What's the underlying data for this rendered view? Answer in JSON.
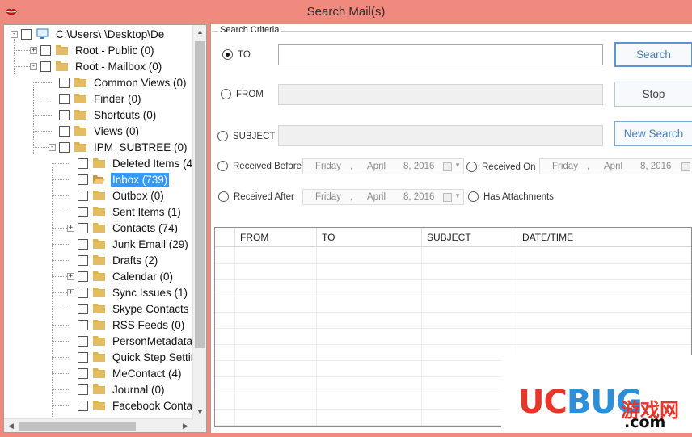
{
  "window": {
    "title": "Search Mail(s)"
  },
  "tree": {
    "items": [
      {
        "label": "C:\\Users\\         \\Desktop\\De",
        "level": 0,
        "expander": "-",
        "icon": "computer-icon"
      },
      {
        "label": "Root - Public (0)",
        "level": 1,
        "expander": "+",
        "icon": "folder-icon"
      },
      {
        "label": "Root - Mailbox (0)",
        "level": 1,
        "expander": "-",
        "icon": "folder-icon"
      },
      {
        "label": "Common Views (0)",
        "level": 2,
        "expander": "",
        "icon": "folder-icon"
      },
      {
        "label": "Finder (0)",
        "level": 2,
        "expander": "",
        "icon": "folder-icon"
      },
      {
        "label": "Shortcuts (0)",
        "level": 2,
        "expander": "",
        "icon": "folder-icon"
      },
      {
        "label": "Views (0)",
        "level": 2,
        "expander": "",
        "icon": "folder-icon"
      },
      {
        "label": "IPM_SUBTREE (0)",
        "level": 2,
        "expander": "-",
        "icon": "folder-icon"
      },
      {
        "label": "Deleted Items (4",
        "level": 3,
        "expander": "",
        "icon": "folder-icon"
      },
      {
        "label": "Inbox (739)",
        "level": 3,
        "expander": "",
        "icon": "open-folder-icon",
        "selected": true
      },
      {
        "label": "Outbox (0)",
        "level": 3,
        "expander": "",
        "icon": "folder-icon"
      },
      {
        "label": "Sent Items (1)",
        "level": 3,
        "expander": "",
        "icon": "folder-icon"
      },
      {
        "label": "Contacts (74)",
        "level": 3,
        "expander": "+",
        "icon": "folder-icon"
      },
      {
        "label": "Junk Email (29)",
        "level": 3,
        "expander": "",
        "icon": "folder-icon"
      },
      {
        "label": "Drafts (2)",
        "level": 3,
        "expander": "",
        "icon": "folder-icon"
      },
      {
        "label": "Calendar (0)",
        "level": 3,
        "expander": "+",
        "icon": "folder-icon"
      },
      {
        "label": "Sync Issues (1)",
        "level": 3,
        "expander": "+",
        "icon": "folder-icon"
      },
      {
        "label": "Skype Contacts (",
        "level": 3,
        "expander": "",
        "icon": "folder-icon"
      },
      {
        "label": "RSS Feeds (0)",
        "level": 3,
        "expander": "",
        "icon": "folder-icon"
      },
      {
        "label": "PersonMetadata",
        "level": 3,
        "expander": "",
        "icon": "folder-icon"
      },
      {
        "label": "Quick Step Settin",
        "level": 3,
        "expander": "",
        "icon": "folder-icon"
      },
      {
        "label": "MeContact (4)",
        "level": 3,
        "expander": "",
        "icon": "folder-icon"
      },
      {
        "label": "Journal (0)",
        "level": 3,
        "expander": "",
        "icon": "folder-icon"
      },
      {
        "label": "Facebook Conta",
        "level": 3,
        "expander": "",
        "icon": "folder-icon"
      }
    ]
  },
  "search_criteria": {
    "legend": "Search Criteria",
    "to_label": "TO",
    "from_label": "FROM",
    "subject_label": "SUBJECT",
    "to_value": "",
    "from_value": "",
    "subject_value": "",
    "selected": "TO",
    "received_before_label": "Received Before",
    "received_on_label": "Received On",
    "received_after_label": "Received After",
    "has_attachments_label": "Has Attachments",
    "date": {
      "weekday": "Friday",
      "sep": ",",
      "month": "April",
      "day_year": "8, 2016"
    }
  },
  "buttons": {
    "search": "Search",
    "stop": "Stop",
    "new_search": "New Search"
  },
  "results": {
    "columns": [
      "FROM",
      "TO",
      "SUBJECT",
      "DATE/TIME"
    ]
  },
  "watermark": {
    "logo_u": "U",
    "logo_c": "C",
    "logo_bug": "BUG",
    "cn": "游戏网",
    "com": ".com"
  },
  "colors": {
    "titlebar": "#f08a7e",
    "selection": "#3399ff",
    "button_text": "#4a7fb5",
    "folder": "#dcb35c"
  }
}
